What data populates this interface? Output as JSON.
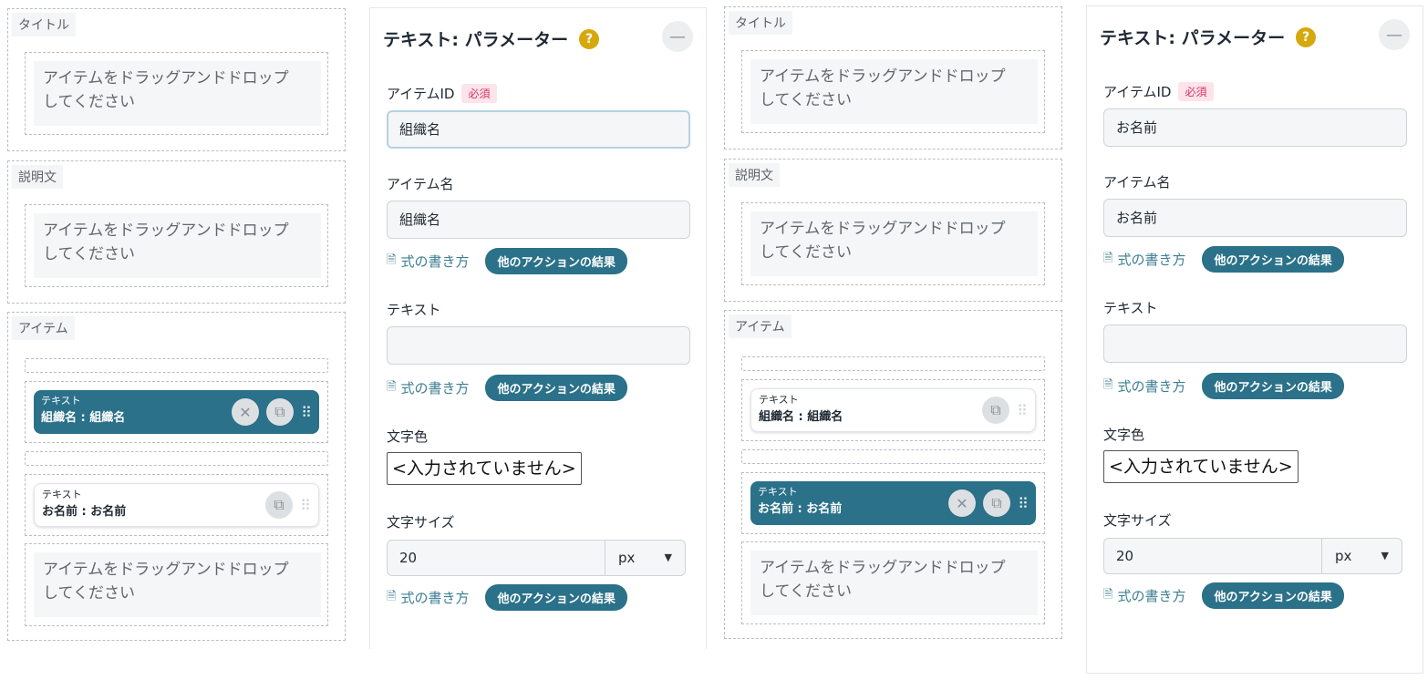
{
  "sections": {
    "title_label": "タイトル",
    "description_label": "説明文",
    "items_label": "アイテム"
  },
  "drop_placeholder": "アイテムをドラッグアンドドロップ\nしてください",
  "cards": {
    "type_label": "テキスト",
    "item1_title": "組織名 : 組織名",
    "item2_title": "お名前 : お名前"
  },
  "param_panel": {
    "title": "テキスト: パラメーター",
    "help_glyph": "?",
    "item_id_label": "アイテムID",
    "required_badge": "必須",
    "item_name_label": "アイテム名",
    "formula_link": "式の書き方",
    "action_result_button": "他のアクションの結果",
    "text_label": "テキスト",
    "text_value": "",
    "color_label": "文字色",
    "color_value": "<入力されていません>",
    "size_label": "文字サイズ",
    "size_value": "20",
    "size_unit": "px"
  },
  "panel_a": {
    "item_id": "組織名",
    "item_name": "組織名",
    "selected_card": "item1"
  },
  "panel_b": {
    "item_id": "お名前",
    "item_name": "お名前",
    "selected_card": "item2"
  },
  "colors": {
    "accent": "#2a7189",
    "help": "#d5a80c",
    "required": "#d3366a"
  }
}
